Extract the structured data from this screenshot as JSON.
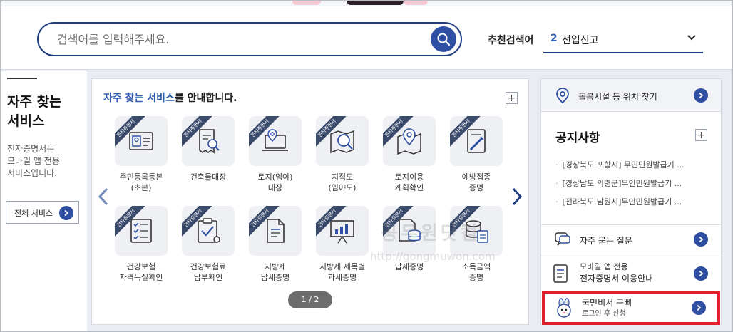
{
  "search": {
    "placeholder": "검색어를 입력해주세요.",
    "recommend_label": "추천검색어",
    "recommend_rank": "2",
    "recommend_term": "전입신고"
  },
  "left": {
    "title_line1": "자주 찾는",
    "title_line2": "서비스",
    "desc_line1": "전자증명서는",
    "desc_line2": "모바일 앱 전용",
    "desc_line3": "서비스입니다.",
    "all_button": "전체 서비스"
  },
  "main": {
    "title_accent": "자주 찾는 서비스",
    "title_rest": "를 안내합니다.",
    "ribbon": "전자증명서",
    "tiles": [
      {
        "label": "주민등록등본\n(초본)",
        "icon": "id-card-icon"
      },
      {
        "label": "건축물대장",
        "icon": "receipt-search-icon"
      },
      {
        "label": "토지(임야)\n대장",
        "icon": "laptop-location-icon"
      },
      {
        "label": "지적도\n(임야도)",
        "icon": "map-search-icon"
      },
      {
        "label": "토지이용\n계획확인",
        "icon": "map-pin-icon"
      },
      {
        "label": "예방접종\n증명",
        "icon": "syringe-doc-icon"
      },
      {
        "label": "건강보험\n자격득실확인",
        "icon": "checklist-icon"
      },
      {
        "label": "건강보험료\n납부확인",
        "icon": "clipboard-check-icon"
      },
      {
        "label": "지방세\n납세증명",
        "icon": "document-icon"
      },
      {
        "label": "지방세 세목별\n과세증명",
        "icon": "presentation-icon"
      },
      {
        "label": "납세증명",
        "icon": "doc-database-icon"
      },
      {
        "label": "소득금액\n증명",
        "icon": "coins-doc-icon"
      }
    ],
    "pager": "1 / 2",
    "watermark": "공무원닷컴",
    "watermark_url": "http://gongmuwon.com"
  },
  "right": {
    "facility": "돌봄시설 등 위치 찾기",
    "notice_title": "공지사항",
    "notices": [
      "[경상북도 포항시] 무인민원발급기 ...",
      "[경상남도 의령군]무인민원발급기 ...",
      "[전라북도 남원시]무인민원발급기 ..."
    ],
    "faq": "자주 묻는 질문",
    "mobile_line1": "모바일 앱 전용",
    "mobile_line2": "전자증명서 이용안내",
    "gov_line1": "국민비서 구삐",
    "gov_line2": "로그인 후 신청"
  },
  "colors": {
    "navy": "#1f3d80",
    "accent_blue": "#2f5db0",
    "highlight_red": "#e0202a"
  }
}
